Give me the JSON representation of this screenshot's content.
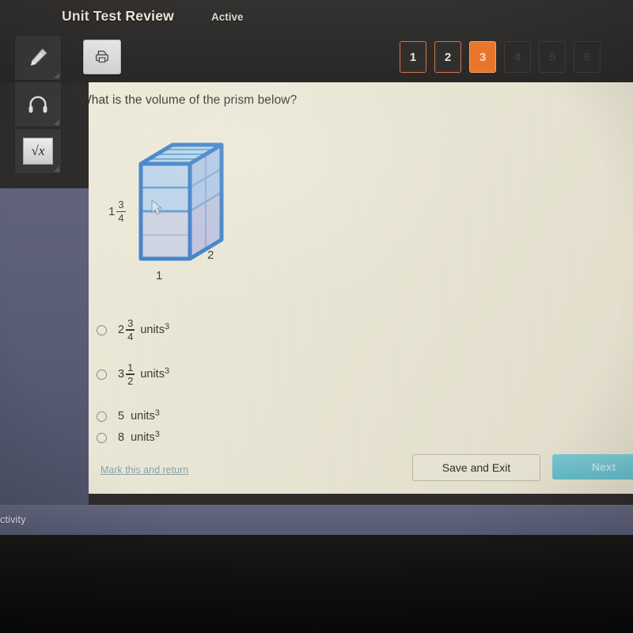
{
  "header": {
    "title": "Unit Test Review",
    "status": "Active",
    "print_icon": "printer-icon"
  },
  "sidebar": {
    "tools": [
      {
        "name": "highlighter-tool",
        "icon": "pencil-icon"
      },
      {
        "name": "audio-tool",
        "icon": "headphones-icon"
      },
      {
        "name": "calculator-tool",
        "icon": "square-root-icon",
        "label": "√x"
      }
    ]
  },
  "pager": {
    "items": [
      {
        "label": "1",
        "state": "visited"
      },
      {
        "label": "2",
        "state": "visited"
      },
      {
        "label": "3",
        "state": "current"
      },
      {
        "label": "4",
        "state": "locked"
      },
      {
        "label": "5",
        "state": "locked"
      },
      {
        "label": "6",
        "state": "locked"
      }
    ]
  },
  "question": {
    "prompt": "What is the volume of the prism below?",
    "figure": {
      "type": "rectangular-prism",
      "height_whole": "1",
      "height_num": "3",
      "height_den": "4",
      "depth_label": "2",
      "width_label": "1"
    },
    "options": [
      {
        "whole": "2",
        "num": "3",
        "den": "4",
        "units": "units",
        "exponent": "3",
        "selected": false
      },
      {
        "whole": "3",
        "num": "1",
        "den": "2",
        "units": "units",
        "exponent": "3",
        "selected": false
      },
      {
        "whole": "5",
        "num": "",
        "den": "",
        "units": "units",
        "exponent": "3",
        "selected": false
      },
      {
        "whole": "8",
        "num": "",
        "den": "",
        "units": "units",
        "exponent": "3",
        "selected": false
      }
    ]
  },
  "footer": {
    "mark_link": "Mark this and return",
    "save_label": "Save and Exit",
    "next_label": "Next"
  },
  "desktop": {
    "taskbar_label": "ctivity"
  },
  "colors": {
    "accent_orange": "#e8762a",
    "next_teal": "#63b9c7",
    "paper": "#e9e5d4",
    "prism_edge": "#3d7fc6"
  }
}
